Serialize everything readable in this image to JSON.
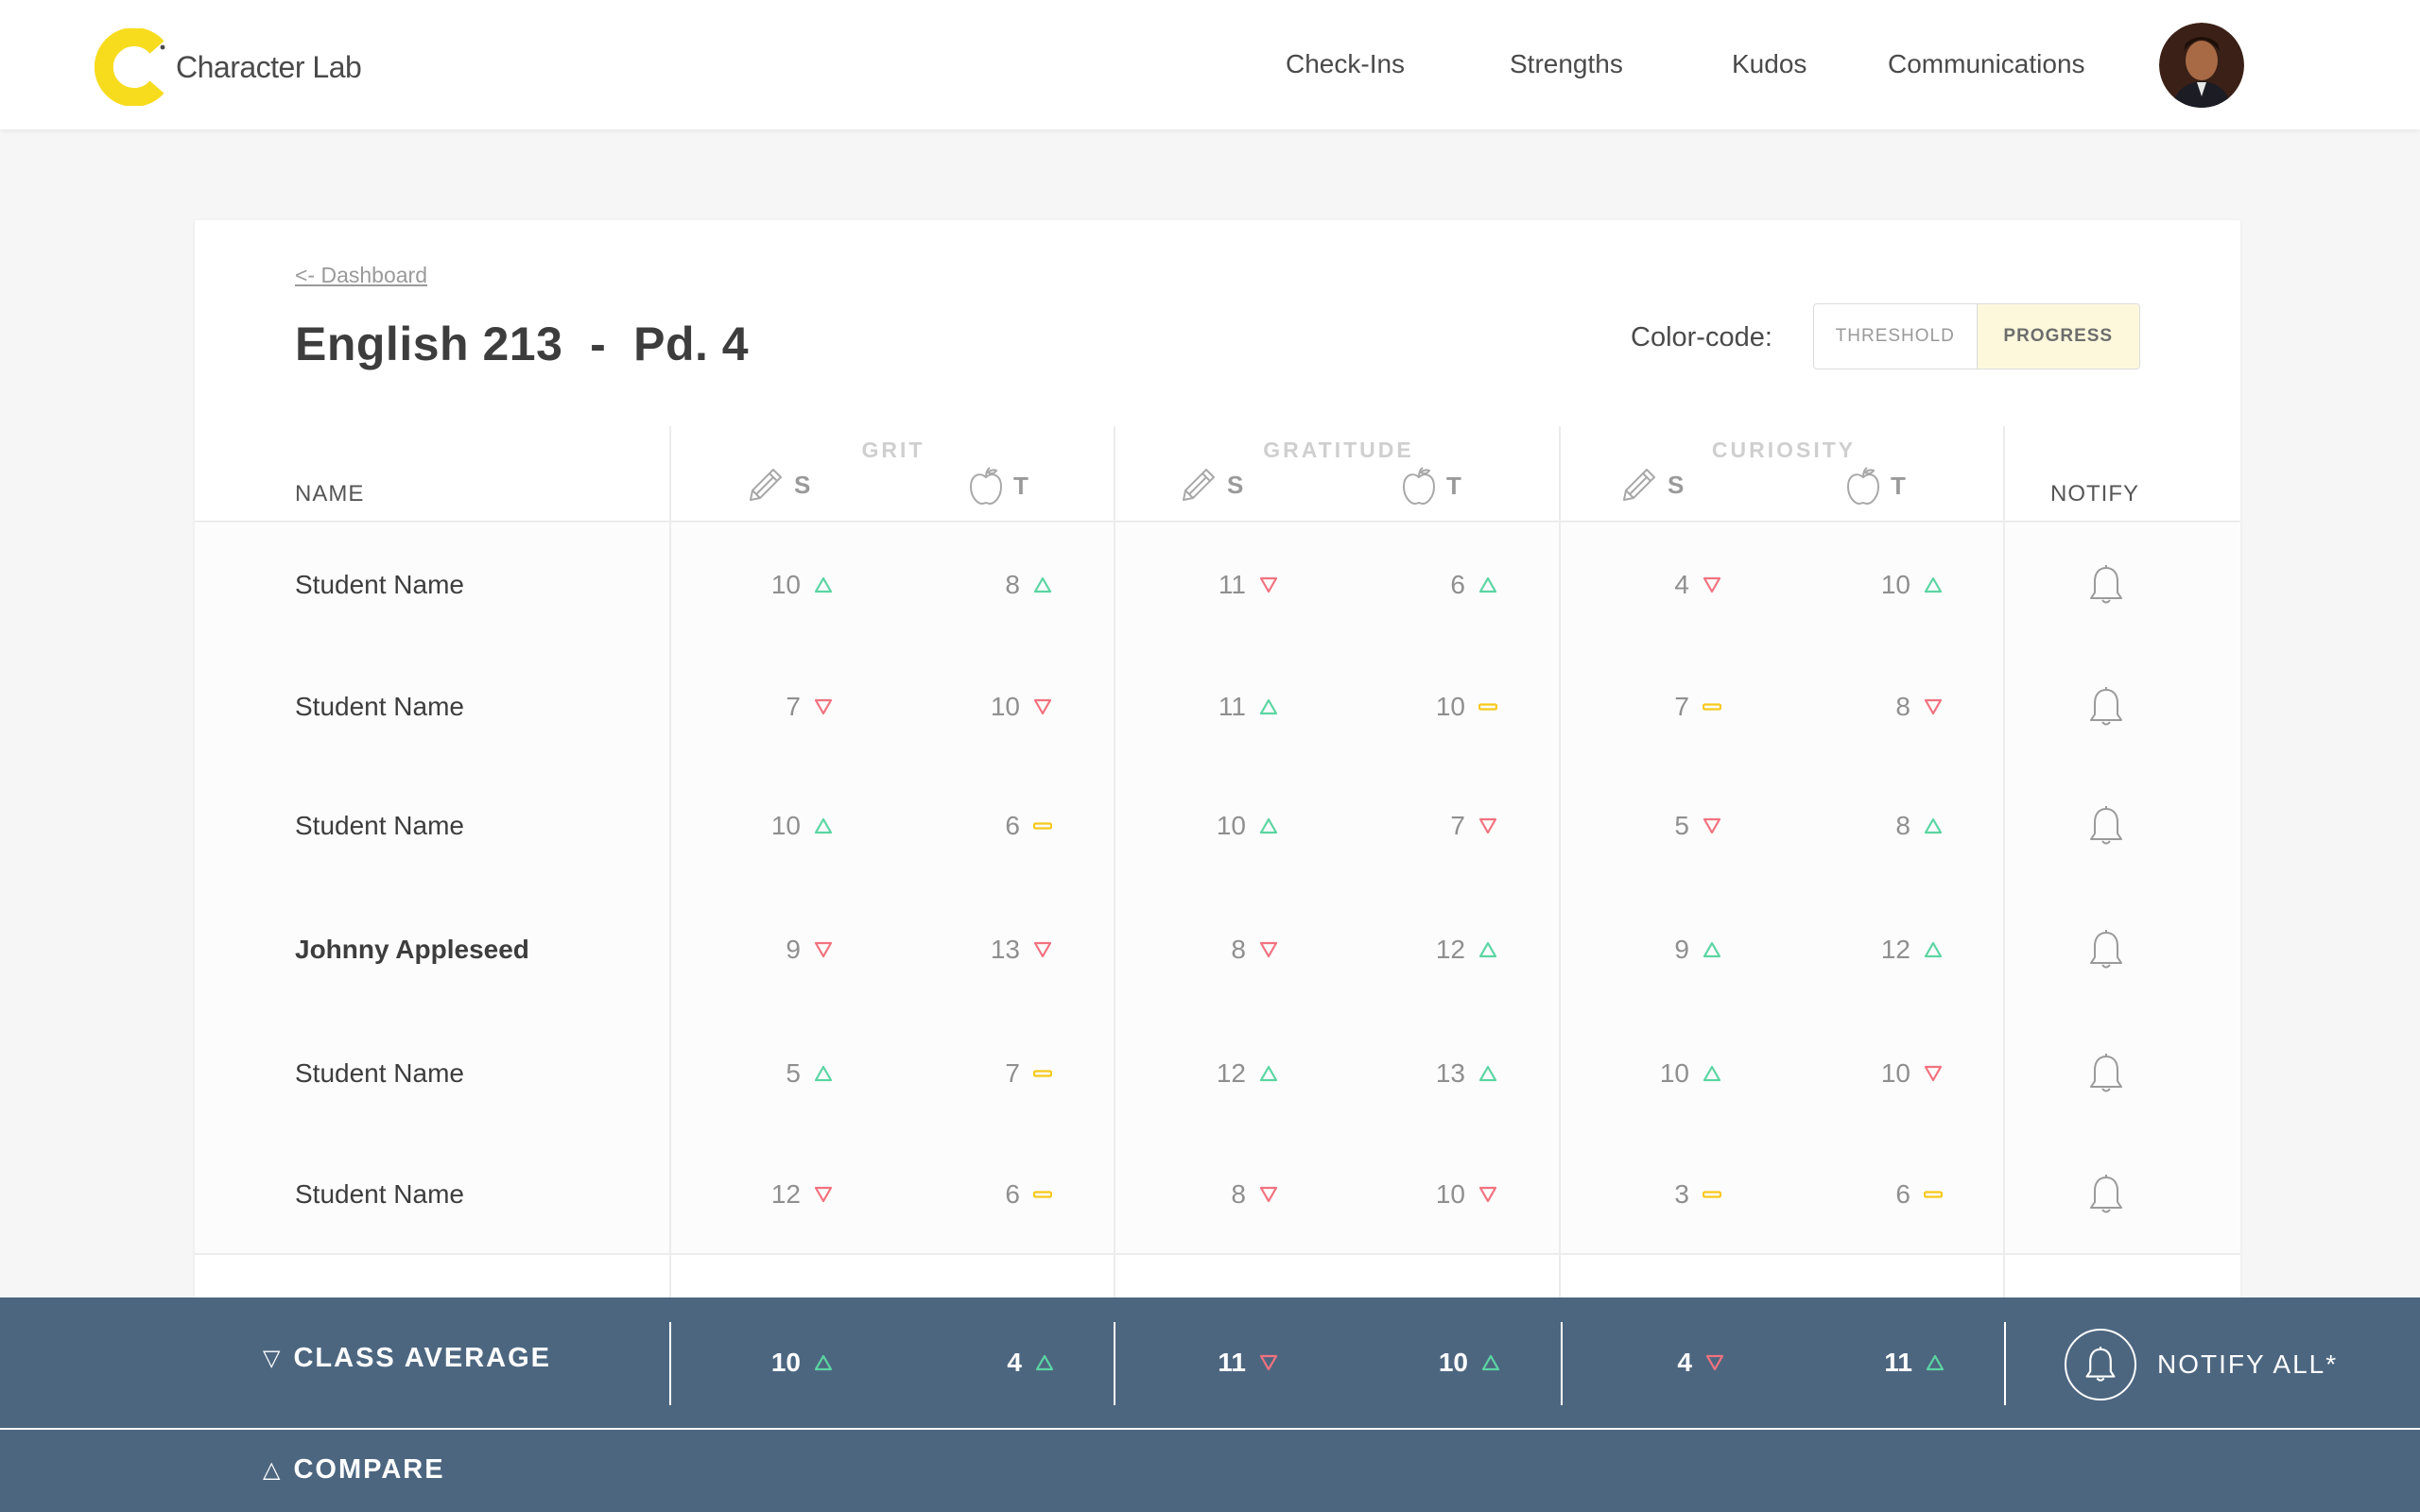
{
  "header": {
    "brand": "Character Lab",
    "nav": [
      "Check-Ins",
      "Strengths",
      "Kudos",
      "Communications"
    ]
  },
  "page": {
    "back_link": "<- Dashboard",
    "title": "English 213  -  Pd. 4",
    "color_code_label": "Color-code:",
    "toggle": {
      "threshold": "THRESHOLD",
      "progress": "PROGRESS",
      "selected": "progress"
    }
  },
  "table": {
    "name_header": "NAME",
    "notify_header": "NOTIFY",
    "groups": [
      "GRIT",
      "GRATITUDE",
      "CURIOSITY"
    ],
    "sub_headers": [
      "S",
      "T"
    ],
    "rows": [
      {
        "name": "Student Name",
        "bold": false,
        "cells": [
          [
            10,
            "up"
          ],
          [
            8,
            "up"
          ],
          [
            11,
            "down"
          ],
          [
            6,
            "up"
          ],
          [
            4,
            "down"
          ],
          [
            10,
            "up"
          ]
        ]
      },
      {
        "name": "Student Name",
        "bold": false,
        "cells": [
          [
            7,
            "down"
          ],
          [
            10,
            "down"
          ],
          [
            11,
            "up"
          ],
          [
            10,
            "flat"
          ],
          [
            7,
            "flat"
          ],
          [
            8,
            "down"
          ]
        ]
      },
      {
        "name": "Student Name",
        "bold": false,
        "cells": [
          [
            10,
            "up"
          ],
          [
            6,
            "flat"
          ],
          [
            10,
            "up"
          ],
          [
            7,
            "down"
          ],
          [
            5,
            "down"
          ],
          [
            8,
            "up"
          ]
        ]
      },
      {
        "name": "Johnny Appleseed",
        "bold": true,
        "cells": [
          [
            9,
            "down"
          ],
          [
            13,
            "down"
          ],
          [
            8,
            "down"
          ],
          [
            12,
            "up"
          ],
          [
            9,
            "up"
          ],
          [
            12,
            "up"
          ]
        ]
      },
      {
        "name": "Student Name",
        "bold": false,
        "cells": [
          [
            5,
            "up"
          ],
          [
            7,
            "flat"
          ],
          [
            12,
            "up"
          ],
          [
            13,
            "up"
          ],
          [
            10,
            "up"
          ],
          [
            10,
            "down"
          ]
        ]
      },
      {
        "name": "Student Name",
        "bold": false,
        "cells": [
          [
            12,
            "down"
          ],
          [
            6,
            "flat"
          ],
          [
            8,
            "down"
          ],
          [
            10,
            "down"
          ],
          [
            3,
            "flat"
          ],
          [
            6,
            "flat"
          ]
        ]
      }
    ]
  },
  "footer": {
    "class_average_label": "CLASS AVERAGE",
    "class_average_icon": "▽",
    "averages": [
      [
        10,
        "up"
      ],
      [
        4,
        "up"
      ],
      [
        11,
        "down"
      ],
      [
        10,
        "up"
      ],
      [
        4,
        "down"
      ],
      [
        11,
        "up"
      ]
    ],
    "notify_all": "NOTIFY ALL*",
    "compare_label": "COMPARE",
    "compare_icon": "△"
  },
  "colors": {
    "up": "#5bd5a2",
    "down": "#f2727f",
    "flat": "#f5c91a",
    "bar": "#4d6680",
    "brand_yellow": "#f7dc1e"
  },
  "icons": {
    "student_column": "pencil-icon",
    "teacher_column": "apple-icon",
    "notify": "bell-icon"
  }
}
